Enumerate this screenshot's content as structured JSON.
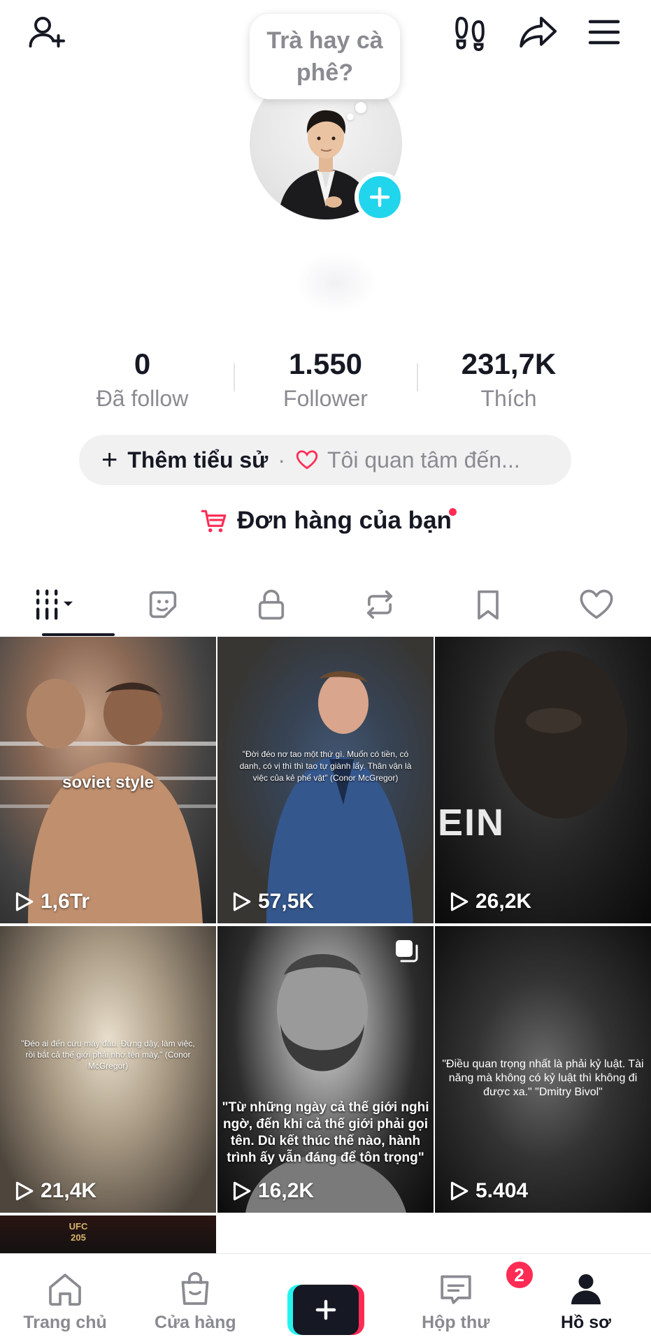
{
  "topbar": {
    "add_friend_icon": "person-add-icon",
    "footprint_icon": "footprints-icon",
    "share_icon": "share-arrow-icon",
    "menu_icon": "hamburger-icon"
  },
  "profile": {
    "bubble_text": "Trà hay cà phê?",
    "avatar_icon": "avatar-photo",
    "add_icon": "plus-icon"
  },
  "stats": [
    {
      "value": "0",
      "label": "Đã follow"
    },
    {
      "value": "1.550",
      "label": "Follower"
    },
    {
      "value": "231,7K",
      "label": "Thích"
    }
  ],
  "bio": {
    "plus": "+",
    "add_label": "Thêm tiểu sử",
    "separator": "·",
    "interest_label": "Tôi quan tâm đến..."
  },
  "orders": {
    "label": "Đơn hàng của bạn",
    "icon": "cart-icon"
  },
  "tabs": [
    {
      "name": "videos",
      "icon": "grid-videos-icon",
      "active": true
    },
    {
      "name": "stickers",
      "icon": "sticker-icon"
    },
    {
      "name": "private",
      "icon": "lock-icon"
    },
    {
      "name": "reposts",
      "icon": "repost-icon"
    },
    {
      "name": "favorites",
      "icon": "bookmark-icon"
    },
    {
      "name": "liked",
      "icon": "heart-icon"
    }
  ],
  "videos": [
    {
      "caption": "soviet style",
      "views": "1,6Tr"
    },
    {
      "caption": "\"Đời đéo nơ tao một thứ gì. Muốn có tiền, có danh, có vị thì thì tao tự giành lấy. Thân vận là việc của kẻ phế vật\" (Conor McGregor)",
      "views": "57,5K"
    },
    {
      "caption": "EIN",
      "views": "26,2K"
    },
    {
      "caption": "\"Đéo ai đến cứu mày đâu. Đứng dậy, làm việc, rồi bắt cả thế giới phải nhớ tên mày.\" (Conor McGregor)",
      "views": "21,4K"
    },
    {
      "caption": "\"Từ những ngày cả thế giới nghi ngờ, đến khi cả thế giới phải gọi tên. Dù kết thúc thế nào, hành trình ấy vẫn đáng để tôn trọng\"",
      "views": "16,2K"
    },
    {
      "caption": "\"Điều quan trọng nhất là phải kỷ luật. Tài năng mà không có kỷ luật thì không đi được xa.\" \"Dmitry Bivol\"",
      "views": "5.404"
    },
    {
      "caption": "UFC 205",
      "views": ""
    }
  ],
  "nav": {
    "home": "Trang chủ",
    "shop": "Cửa hàng",
    "inbox": "Hộp thư",
    "inbox_badge": "2",
    "profile": "Hồ sơ"
  }
}
